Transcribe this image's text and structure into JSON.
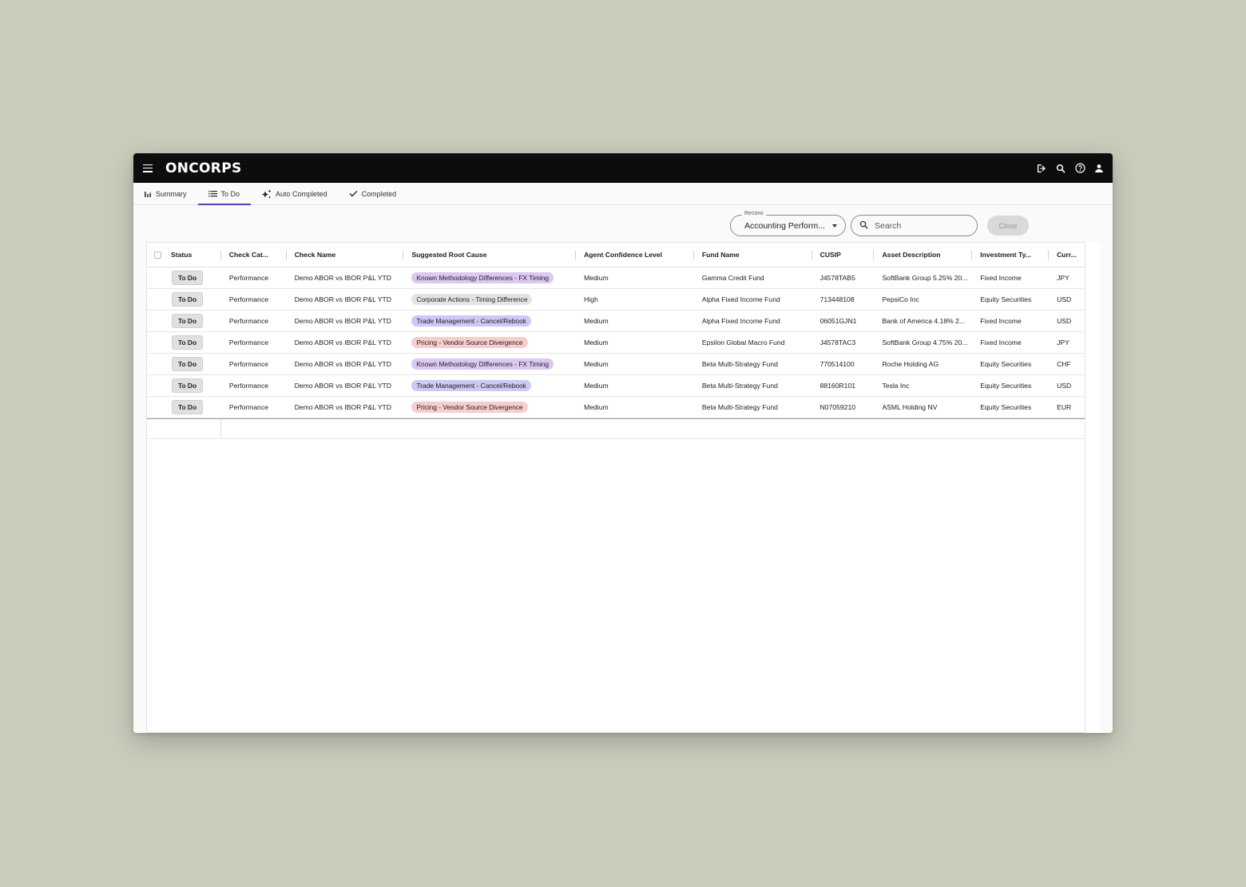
{
  "app": {
    "logo": "ONCORPS"
  },
  "tabs": [
    {
      "label": "Summary",
      "icon": "bar-chart-icon",
      "active": false
    },
    {
      "label": "To Do",
      "icon": "list-icon",
      "active": true
    },
    {
      "label": "Auto Completed",
      "icon": "sparkle-icon",
      "active": false
    },
    {
      "label": "Completed",
      "icon": "check-icon",
      "active": false
    }
  ],
  "filters": {
    "recons_label": "Recons",
    "recons_value": "Accounting Perform...",
    "search_placeholder": "Search",
    "close_label": "Close"
  },
  "table": {
    "columns": [
      "Status",
      "Check Cat...",
      "Check Name",
      "Suggested Root Cause",
      "Agent Confidence Level",
      "Fund Name",
      "CUSIP",
      "Asset Description",
      "Investment Ty...",
      "Curr..."
    ],
    "rows": [
      {
        "status": "To Do",
        "category": "Performance",
        "check_name": "Demo ABOR vs IBOR P&L YTD",
        "root_cause": "Known Methodology Differences - FX Timing",
        "confidence": "Medium",
        "fund": "Gamma Credit Fund",
        "cusip": "J4578TAB5",
        "asset": "SoftBank Group 5.25% 20...",
        "investment_type": "Fixed Income",
        "currency": "JPY"
      },
      {
        "status": "To Do",
        "category": "Performance",
        "check_name": "Demo ABOR vs IBOR P&L YTD",
        "root_cause": "Corporate Actions - Timing Difference",
        "confidence": "High",
        "fund": "Alpha Fixed Income Fund",
        "cusip": "713448108",
        "asset": "PepsiCo Inc",
        "investment_type": "Equity Securities",
        "currency": "USD"
      },
      {
        "status": "To Do",
        "category": "Performance",
        "check_name": "Demo ABOR vs IBOR P&L YTD",
        "root_cause": "Trade Management - Cancel/Rebook",
        "confidence": "Medium",
        "fund": "Alpha Fixed Income Fund",
        "cusip": "06051GJN1",
        "asset": "Bank of America 4.18% 2...",
        "investment_type": "Fixed Income",
        "currency": "USD"
      },
      {
        "status": "To Do",
        "category": "Performance",
        "check_name": "Demo ABOR vs IBOR P&L YTD",
        "root_cause": "Pricing - Vendor Source Divergence",
        "confidence": "Medium",
        "fund": "Epsilon Global Macro Fund",
        "cusip": "J4578TAC3",
        "asset": "SoftBank Group 4.75% 20...",
        "investment_type": "Fixed Income",
        "currency": "JPY"
      },
      {
        "status": "To Do",
        "category": "Performance",
        "check_name": "Demo ABOR vs IBOR P&L YTD",
        "root_cause": "Known Methodology Differences - FX Timing",
        "confidence": "Medium",
        "fund": "Beta Multi-Strategy Fund",
        "cusip": "770514100",
        "asset": "Roche Holding AG",
        "investment_type": "Equity Securities",
        "currency": "CHF"
      },
      {
        "status": "To Do",
        "category": "Performance",
        "check_name": "Demo ABOR vs IBOR P&L YTD",
        "root_cause": "Trade Management - Cancel/Rebook",
        "confidence": "Medium",
        "fund": "Beta Multi-Strategy Fund",
        "cusip": "88160R101",
        "asset": "Tesla Inc",
        "investment_type": "Equity Securities",
        "currency": "USD"
      },
      {
        "status": "To Do",
        "category": "Performance",
        "check_name": "Demo ABOR vs IBOR P&L YTD",
        "root_cause": "Pricing - Vendor Source Divergence",
        "confidence": "Medium",
        "fund": "Beta Multi-Strategy Fund",
        "cusip": "N07059210",
        "asset": "ASML Holding NV",
        "investment_type": "Equity Securities",
        "currency": "EUR"
      }
    ]
  },
  "chip_colors": {
    "Known Methodology Differences - FX Timing": "#dcc8f3",
    "Corporate Actions - Timing Difference": "#e4e4e4",
    "Trade Management - Cancel/Rebook": "#cdc9f6",
    "Pricing - Vendor Source Divergence": "#f7cdcd"
  },
  "colors": {
    "accent": "#4b44b7",
    "topbar": "#0c0d0e",
    "background": "#cacbbb"
  }
}
